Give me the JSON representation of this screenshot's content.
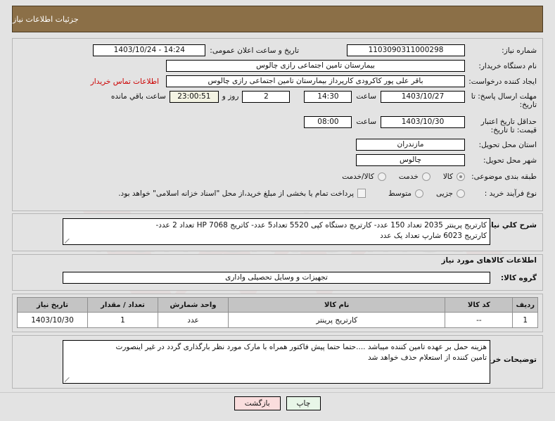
{
  "header": {
    "title": "جزئیات اطلاعات نیاز"
  },
  "form": {
    "need_number_label": "شماره نیاز:",
    "need_number_value": "1103090311000298",
    "announce_label": "تاریخ و ساعت اعلان عمومی:",
    "announce_value": "14:24 - 1403/10/24",
    "buyer_org_label": "نام دستگاه خریدار:",
    "buyer_org_value": "بیمارستان تامین اجتماعی رازی چالوس",
    "requester_label": "ایجاد کننده درخواست:",
    "requester_value": "باقر علی پور کاکرودی کارپرداز بیمارستان تامین اجتماعی رازی چالوس",
    "contact_link": "اطلاعات تماس خریدار",
    "deadline_label": "مهلت ارسال پاسخ: تا تاریخ:",
    "deadline_date": "1403/10/27",
    "deadline_hour_label": "ساعت",
    "deadline_time": "14:30",
    "remaining_days": "2",
    "remaining_days_label": "روز و",
    "remaining_clock": "23:00:51",
    "remaining_clock_label": "ساعت باقي مانده",
    "validity_label": "حداقل تاریخ اعتبار قیمت: تا تاریخ:",
    "validity_date": "1403/10/30",
    "validity_hour_label": "ساعت",
    "validity_time": "08:00",
    "province_label": "استان محل تحویل:",
    "province_value": "مازندران",
    "city_label": "شهر محل تحویل:",
    "city_value": "چالوس",
    "category_label": "طبقه بندی موضوعی:",
    "category_options": [
      "کالا",
      "خدمت",
      "کالا/خدمت"
    ],
    "category_selected": 0,
    "process_label": "نوع فرآیند خرید :",
    "process_options": [
      "جزیی",
      "متوسط"
    ],
    "process_selected": -1,
    "treasury_checkbox_text": "پرداخت تمام یا بخشی از مبلغ خرید،از محل \"اسناد خزانه اسلامی\" خواهد بود."
  },
  "description": {
    "label": "شرح کلي نیاز:",
    "line1": "کارتریج پرینتر 2035 تعداد 150 عدد- کارتریج دستگاه کپی 5520 تعداد5 عدد- کاتریج HP 7068  تعداد 2 عدد-",
    "line2": "کارتریج 6023  شارپ تعداد  یک عدد"
  },
  "goods": {
    "section_title": "اطلاعات کالاهای مورد نیاز",
    "group_label": "گروه کالا:",
    "group_value": "تجهیزات و وسایل تحصیلی واداری"
  },
  "table": {
    "columns": [
      "ردیف",
      "کد کالا",
      "نام کالا",
      "واحد شمارش",
      "تعداد / مقدار",
      "تاریخ نیاز"
    ],
    "rows": [
      [
        "1",
        "--",
        "کارتریج پرینتر",
        "عدد",
        "1",
        "1403/10/30"
      ]
    ]
  },
  "notes": {
    "label": "توضیحات خریدار:",
    "line1": "هزینه حمل بر عهده تامین کننده میباشد ....حتما حتما پیش فاکتور  همراه با مارک مورد نظر بارگذاری گردد در غیر اینصورت",
    "line2": "تامین کننده از استعلام حذف خواهد شد"
  },
  "footer": {
    "print_label": "چاپ",
    "back_label": "بازگشت"
  },
  "watermark": {
    "text": "iranTender.net"
  },
  "colors": {
    "header_bg": "#8b6f47",
    "page_bg": "#e3e3e3",
    "link_red": "#cc0000",
    "table_header_bg": "#c4c4c4",
    "print_btn_bg": "#e8f6e8",
    "back_btn_bg": "#fadddd"
  }
}
